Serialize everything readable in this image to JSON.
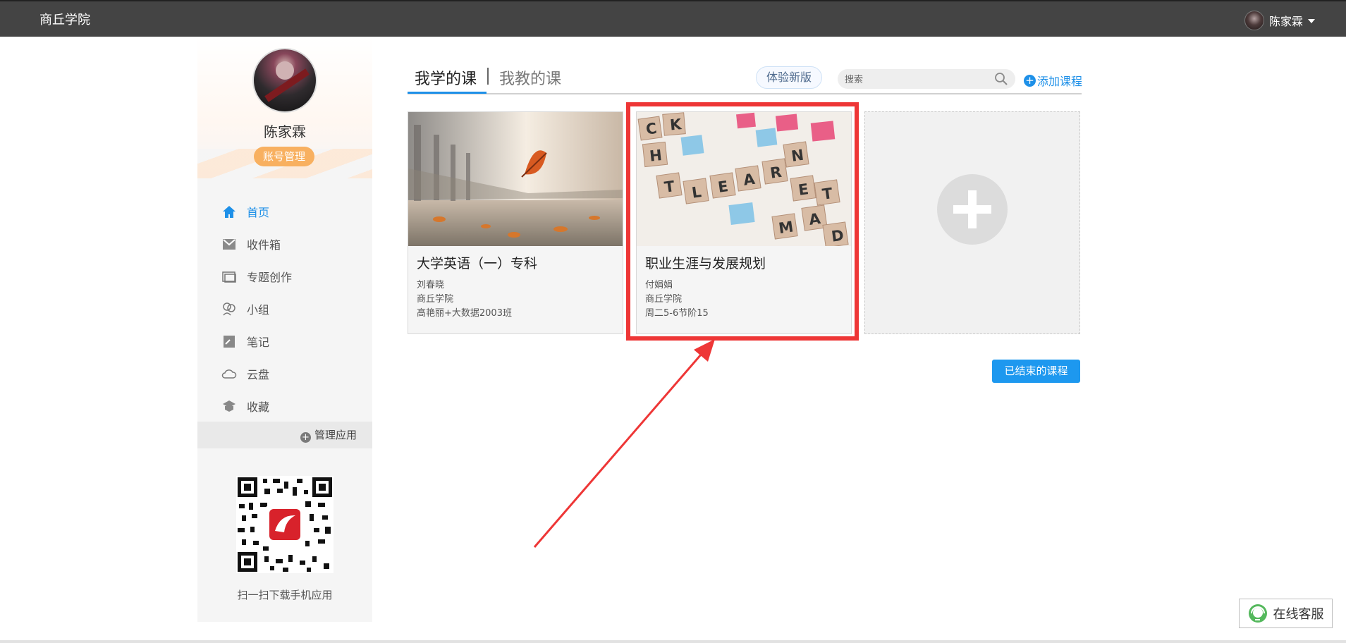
{
  "header": {
    "school": "商丘学院",
    "username": "陈家霖"
  },
  "profile": {
    "name": "陈家霖",
    "account_button": "账号管理"
  },
  "sidebar": {
    "items": [
      {
        "label": "首页",
        "icon": "home-icon",
        "active": true
      },
      {
        "label": "收件箱",
        "icon": "inbox-icon"
      },
      {
        "label": "专题创作",
        "icon": "topic-icon"
      },
      {
        "label": "小组",
        "icon": "group-icon"
      },
      {
        "label": "笔记",
        "icon": "note-icon"
      },
      {
        "label": "云盘",
        "icon": "cloud-icon"
      },
      {
        "label": "收藏",
        "icon": "favorite-icon"
      }
    ],
    "manage_apps": "管理应用",
    "qr_caption": "扫一扫下载手机应用"
  },
  "tabs": {
    "my_learning": "我学的课",
    "my_teaching": "我教的课"
  },
  "toolbar": {
    "try_new": "体验新版",
    "search_placeholder": "搜索",
    "add_course": "添加课程"
  },
  "courses": [
    {
      "name": "大学英语（一）专科",
      "teacher": "刘春晓",
      "school": "商丘学院",
      "class": "高艳丽+大数据2003班"
    },
    {
      "name": "职业生涯与发展规划",
      "teacher": "付娟娟",
      "school": "商丘学院",
      "class": "周二5-6节阶15"
    }
  ],
  "footer": {
    "finished_courses": "已结束的课程",
    "support": "在线客服"
  },
  "colors": {
    "topbar": "#444444",
    "accent": "#1e90e8",
    "highlight": "#ee3636",
    "account": "#f8b060"
  }
}
